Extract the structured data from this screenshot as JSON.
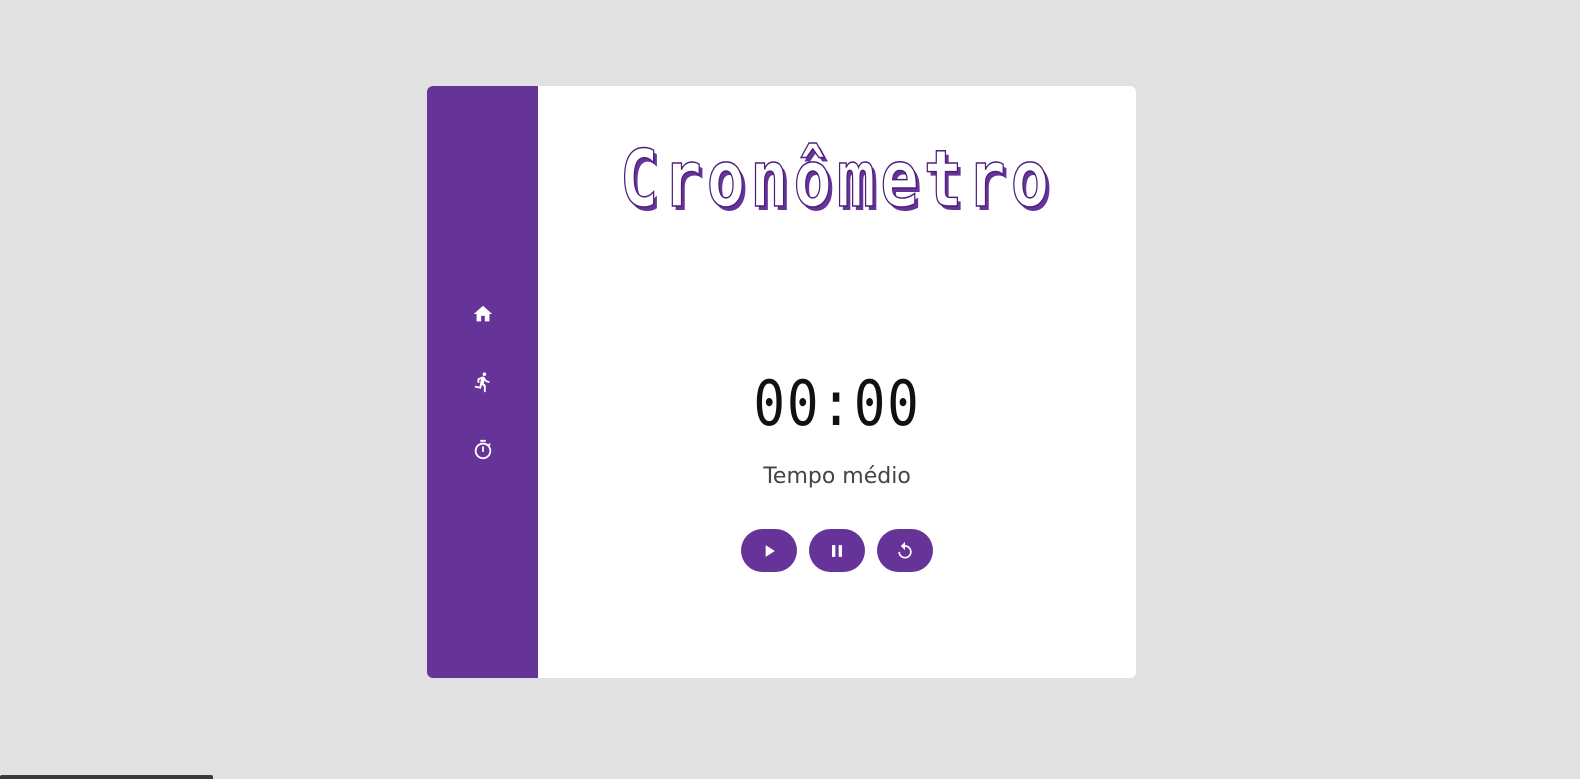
{
  "sidebar": {
    "items": [
      {
        "icon": "home-icon"
      },
      {
        "icon": "running-person-icon"
      },
      {
        "icon": "stopwatch-icon"
      }
    ],
    "color": "#663399"
  },
  "main": {
    "title": "Cronômetro",
    "time_display": "00:00",
    "subtitle": "Tempo médio"
  },
  "controls": {
    "buttons": [
      {
        "icon": "play-icon"
      },
      {
        "icon": "pause-icon"
      },
      {
        "icon": "reset-icon"
      }
    ]
  },
  "colors": {
    "background": "#e1e1e1",
    "accent": "#663399",
    "card": "#ffffff"
  }
}
